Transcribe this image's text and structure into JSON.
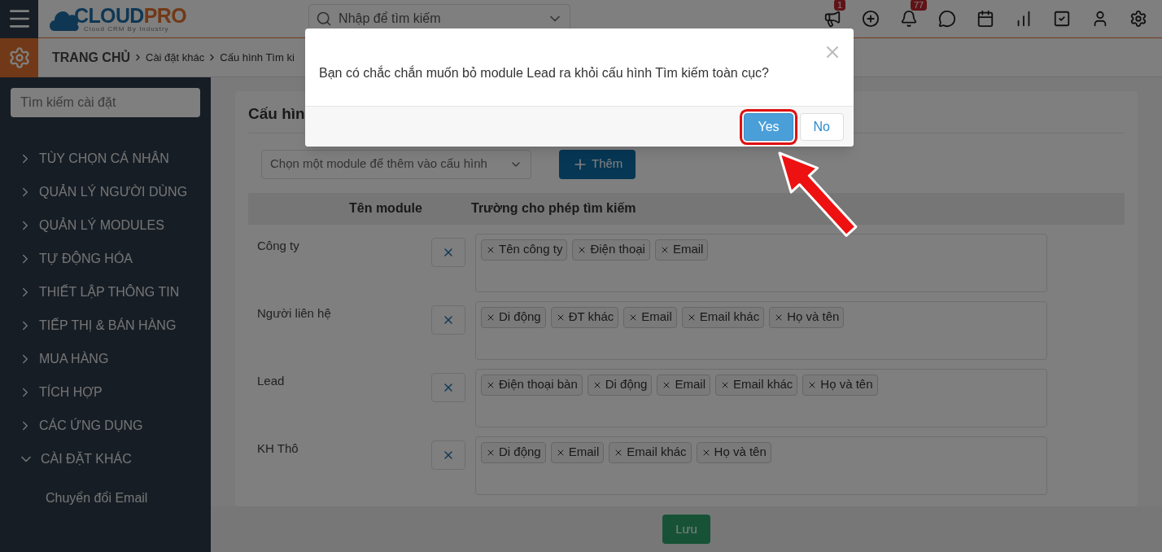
{
  "header": {
    "logo": {
      "brand_1": "CLOUD",
      "brand_2": "PRO",
      "tagline": "Cloud CRM By Industry"
    },
    "search": {
      "placeholder": "Nhập để tìm kiếm"
    },
    "toolbar": [
      {
        "kind": "megaphone",
        "badge": "1"
      },
      {
        "kind": "add"
      },
      {
        "kind": "bell",
        "badge": "77"
      },
      {
        "kind": "chat"
      },
      {
        "kind": "calendar"
      },
      {
        "kind": "chart"
      },
      {
        "kind": "task"
      },
      {
        "kind": "user"
      },
      {
        "kind": "settings"
      }
    ]
  },
  "breadcrumb": [
    "TRANG CHỦ",
    "Cài đặt khác",
    "Cấu hình Tìm ki"
  ],
  "sidebar": {
    "search": {
      "placeholder": "Tìm kiếm cài đặt"
    },
    "items": [
      {
        "label": "TÙY CHỌN CÁ NHÂN",
        "expanded": false
      },
      {
        "label": "QUẢN LÝ NGƯỜI DÙNG",
        "expanded": false
      },
      {
        "label": "QUẢN LÝ MODULES",
        "expanded": false
      },
      {
        "label": "TỰ ĐỘNG HÓA",
        "expanded": false
      },
      {
        "label": "THIẾT LẬP THÔNG TIN",
        "expanded": false
      },
      {
        "label": "TIẾP THỊ & BÁN HÀNG",
        "expanded": false
      },
      {
        "label": "MUA HÀNG",
        "expanded": false
      },
      {
        "label": "TÍCH HỢP",
        "expanded": false
      },
      {
        "label": "CÁC ỨNG DỤNG",
        "expanded": false
      },
      {
        "label": "CÀI ĐẶT KHÁC",
        "expanded": true,
        "children": [
          {
            "label": "Chuyển đổi Email"
          }
        ]
      }
    ]
  },
  "card": {
    "title": "Cấu hìn",
    "module_select": {
      "placeholder": "Chọn một module để thêm vào cấu hình"
    },
    "add_button": "Thêm",
    "columns": [
      "Tên module",
      "Trường cho phép tìm kiếm"
    ],
    "rows": [
      {
        "module": "Công ty",
        "fields": [
          "Tên công ty",
          "Điện thoại",
          "Email"
        ]
      },
      {
        "module": "Người liên hệ",
        "fields": [
          "Di động",
          "ĐT khác",
          "Email",
          "Email khác",
          "Họ và tên"
        ]
      },
      {
        "module": "Lead",
        "fields": [
          "Điện thoại bàn",
          "Di động",
          "Email",
          "Email khác",
          "Họ và tên"
        ]
      },
      {
        "module": "KH Thô",
        "fields": [
          "Di động",
          "Email",
          "Email khác",
          "Họ và tên"
        ]
      }
    ]
  },
  "footer": {
    "save_button": "Lưu"
  },
  "dialog": {
    "message": "Bạn có chắc chắn muốn bỏ module Lead ra khỏi cấu hình Tìm kiếm toàn cục?",
    "buttons": [
      {
        "label": "Yes",
        "kind": "primary",
        "highlighted": true
      },
      {
        "label": "No",
        "kind": "secondary",
        "highlighted": false
      }
    ]
  }
}
